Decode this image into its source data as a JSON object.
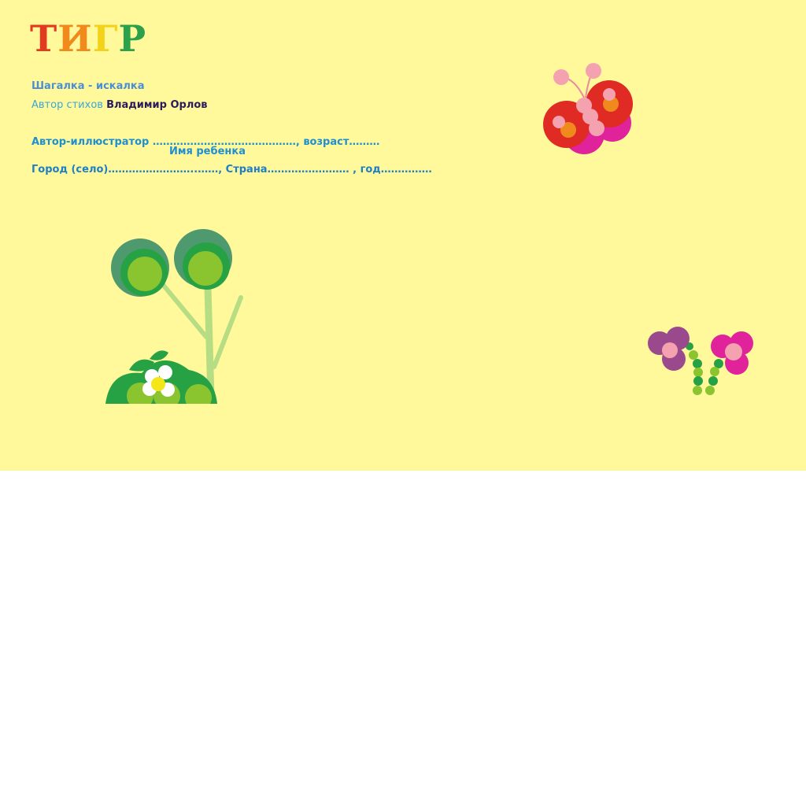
{
  "logo": {
    "letters": [
      "Т",
      "И",
      "Г",
      "Р"
    ],
    "colors": [
      "#e23a1f",
      "#f08a1c",
      "#f5d21a",
      "#2aa14a"
    ]
  },
  "card": {
    "title": "Шагалка - искалка",
    "author_label": "Автор  стихов",
    "author_name": "Владимир  Орлов",
    "illustrator_line": "Автор-иллюстратор ……………………………………, возраст………",
    "child_name_label": "Имя ребенка",
    "city_line": "Город (село)……………………..……,  Страна…………………… , год……………"
  },
  "colors": {
    "background": "#fff99b",
    "page": "#ffffff"
  }
}
